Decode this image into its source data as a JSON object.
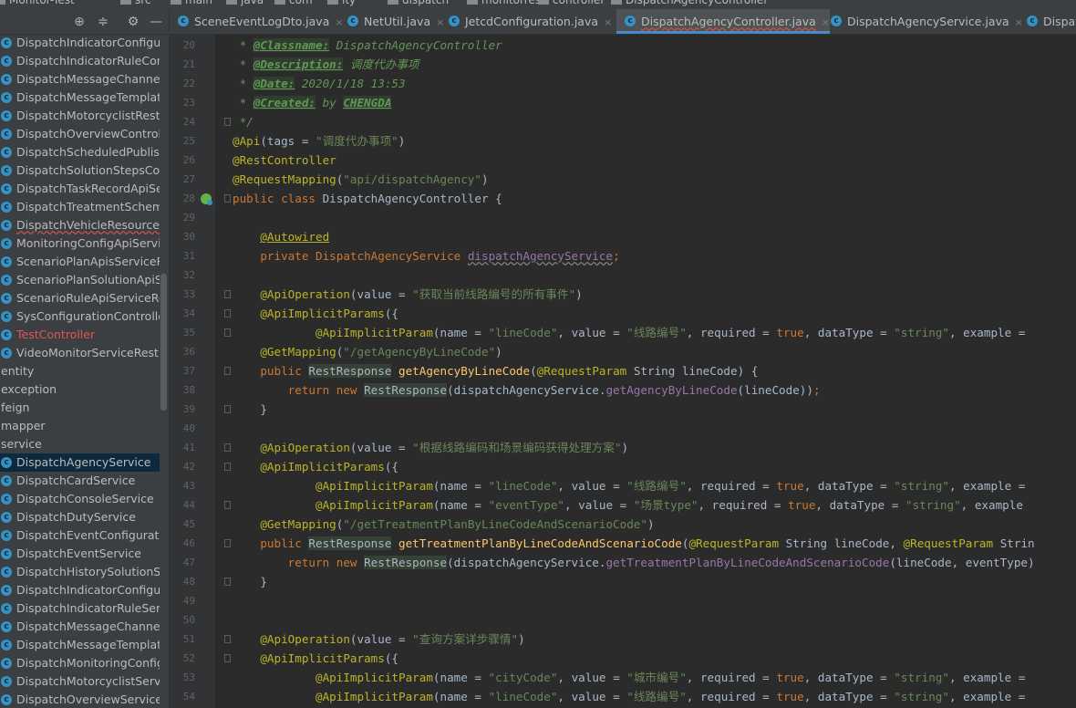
{
  "breadcrumb": [
    "Monitor-Test",
    "src",
    "main",
    "java",
    "com",
    "ity",
    "dispatch",
    "monitorrest",
    "controller",
    "DispatchAgencyController"
  ],
  "project_toolbar": {
    "target_icon": "⊕",
    "collapse_icon": "≑",
    "settings_icon": "⚙",
    "hide_icon": "—"
  },
  "tree": [
    {
      "label": "DispatchIndicatorConfigurati",
      "kind": "class"
    },
    {
      "label": "DispatchIndicatorRuleContro",
      "kind": "class"
    },
    {
      "label": "DispatchMessageChannelCor",
      "kind": "class"
    },
    {
      "label": "DispatchMessageTemplateCc",
      "kind": "class"
    },
    {
      "label": "DispatchMotorcyclistRest",
      "kind": "class"
    },
    {
      "label": "DispatchOverviewController",
      "kind": "class"
    },
    {
      "label": "DispatchScheduledPublished",
      "kind": "class"
    },
    {
      "label": "DispatchSolutionStepsContro",
      "kind": "class"
    },
    {
      "label": "DispatchTaskRecordApiServi",
      "kind": "class"
    },
    {
      "label": "DispatchTreatmentSchemeCo",
      "kind": "class"
    },
    {
      "label": "DispatchVehicleResourceRes",
      "kind": "class",
      "state": "squig"
    },
    {
      "label": "MonitoringConfigApiServiceF",
      "kind": "class"
    },
    {
      "label": "ScenarioPlanApisServiceRest",
      "kind": "class"
    },
    {
      "label": "ScenarioPlanSolutionApiServ",
      "kind": "class"
    },
    {
      "label": "ScenarioRuleApiServiceRest",
      "kind": "class"
    },
    {
      "label": "SysConfigurationController",
      "kind": "class"
    },
    {
      "label": "TestController",
      "kind": "class",
      "state": "error"
    },
    {
      "label": "VideoMonitorServiceRest",
      "kind": "class"
    },
    {
      "label": "entity",
      "kind": "folder"
    },
    {
      "label": "exception",
      "kind": "folder"
    },
    {
      "label": "feign",
      "kind": "folder"
    },
    {
      "label": "mapper",
      "kind": "folder"
    },
    {
      "label": "service",
      "kind": "folder"
    },
    {
      "label": "DispatchAgencyService",
      "kind": "class",
      "state": "selected"
    },
    {
      "label": "DispatchCardService",
      "kind": "class"
    },
    {
      "label": "DispatchConsoleService",
      "kind": "class"
    },
    {
      "label": "DispatchDutyService",
      "kind": "class"
    },
    {
      "label": "DispatchEventConfigurationS",
      "kind": "class"
    },
    {
      "label": "DispatchEventService",
      "kind": "class"
    },
    {
      "label": "DispatchHistorySolutionServi",
      "kind": "class"
    },
    {
      "label": "DispatchIndicatorConfigurati",
      "kind": "class"
    },
    {
      "label": "DispatchIndicatorRuleService",
      "kind": "class"
    },
    {
      "label": "DispatchMessageChannelSer",
      "kind": "class"
    },
    {
      "label": "DispatchMessageTemplateSe",
      "kind": "class"
    },
    {
      "label": "DispatchMonitoringConfigSe",
      "kind": "class"
    },
    {
      "label": "DispatchMotorcyclistService",
      "kind": "class"
    },
    {
      "label": "DispatchOverviewService",
      "kind": "class"
    }
  ],
  "tabs": [
    {
      "label": "SceneEventLogDto.java",
      "close": "×"
    },
    {
      "label": "NetUtil.java",
      "close": "×"
    },
    {
      "label": "JetcdConfiguration.java",
      "close": "×"
    },
    {
      "label": "DispatchAgencyController.java",
      "close": "×",
      "active": true
    },
    {
      "label": "DispatchAgencyService.java",
      "close": "×"
    },
    {
      "label": "Dispatch",
      "close": ""
    }
  ],
  "code": {
    "line_numbers": [
      "20",
      "21",
      "22",
      "23",
      "24",
      "25",
      "26",
      "27",
      "28",
      "29",
      "30",
      "31",
      "32",
      "33",
      "34",
      "35",
      "36",
      "37",
      "38",
      "39",
      "40",
      "41",
      "42",
      "43",
      "44",
      "45",
      "46",
      "47",
      "48",
      "49",
      "50",
      "51",
      "52",
      "53",
      "54"
    ],
    "lines": [
      [
        [
          "c-cm",
          " * "
        ],
        [
          "c-tag",
          "@Classname:"
        ],
        [
          "c-cm",
          " DispatchAgencyController"
        ]
      ],
      [
        [
          "c-cm",
          " * "
        ],
        [
          "c-tag",
          "@Description:"
        ],
        [
          "c-cm",
          " 调度代办事项"
        ]
      ],
      [
        [
          "c-cm",
          " * "
        ],
        [
          "c-tag",
          "@Date:"
        ],
        [
          "c-cm",
          " 2020/1/18 13:53"
        ]
      ],
      [
        [
          "c-cm",
          " * "
        ],
        [
          "c-tag",
          "@Created:"
        ],
        [
          "c-cm",
          " by "
        ],
        [
          "c-tag",
          "CHENGDA"
        ]
      ],
      [
        [
          "c-cm",
          " */"
        ]
      ],
      [
        [
          "c-ann",
          "@Api"
        ],
        [
          "",
          "(tags = "
        ],
        [
          "c-str",
          "\"调度代办事项\""
        ],
        [
          "",
          ")"
        ]
      ],
      [
        [
          "c-ann",
          "@RestController"
        ]
      ],
      [
        [
          "c-ann",
          "@RequestMapping"
        ],
        [
          "",
          "("
        ],
        [
          "c-str",
          "\"api/dispatchAgency\""
        ],
        [
          "",
          ")"
        ]
      ],
      [
        [
          "c-kw",
          "public class "
        ],
        [
          "",
          "DispatchAgencyController {"
        ]
      ],
      [
        [
          "",
          ""
        ]
      ],
      [
        [
          "",
          "    "
        ],
        [
          "c-ann-u",
          "@Autowired"
        ]
      ],
      [
        [
          "",
          "    "
        ],
        [
          "c-kw",
          "private "
        ],
        [
          "c-err",
          "DispatchAgencyService "
        ],
        [
          "c-fld",
          "dispatchAgencyService"
        ],
        [
          "c-kw",
          ";"
        ]
      ],
      [
        [
          "",
          ""
        ]
      ],
      [
        [
          "",
          "    "
        ],
        [
          "c-ann",
          "@ApiOperation"
        ],
        [
          "",
          "(value = "
        ],
        [
          "c-str",
          "\"获取当前线路编号的所有事件\""
        ],
        [
          "",
          ")"
        ]
      ],
      [
        [
          "",
          "    "
        ],
        [
          "c-ann",
          "@ApiImplicitParams"
        ],
        [
          "",
          "({"
        ]
      ],
      [
        [
          "",
          "            "
        ],
        [
          "c-ann",
          "@ApiImplicitParam"
        ],
        [
          "",
          "(name = "
        ],
        [
          "c-str",
          "\"lineCode\""
        ],
        [
          "",
          ", value = "
        ],
        [
          "c-str",
          "\"线路编号\""
        ],
        [
          "",
          ", required = "
        ],
        [
          "c-kw",
          "true"
        ],
        [
          "",
          ", dataType = "
        ],
        [
          "c-str",
          "\"string\""
        ],
        [
          "",
          ", example = "
        ]
      ],
      [
        [
          "",
          "    "
        ],
        [
          "c-ann",
          "@GetMapping"
        ],
        [
          "",
          "("
        ],
        [
          "c-str",
          "\"/getAgencyByLineCode\""
        ],
        [
          "",
          ")"
        ]
      ],
      [
        [
          "",
          "    "
        ],
        [
          "c-kw",
          "public "
        ],
        [
          "c-cls",
          "RestResponse"
        ],
        [
          "c-mth",
          " getAgencyByLineCode"
        ],
        [
          "",
          "("
        ],
        [
          "c-ann",
          "@RequestParam"
        ],
        [
          "",
          " String lineCode) {"
        ]
      ],
      [
        [
          "",
          "        "
        ],
        [
          "c-kw",
          "return new "
        ],
        [
          "c-cls",
          "RestResponse"
        ],
        [
          "",
          "(dispatchAgencyService."
        ],
        [
          "c-mcall",
          "getAgencyByLineCode"
        ],
        [
          "",
          "(lineCode))"
        ],
        [
          "c-kw",
          ";"
        ]
      ],
      [
        [
          "",
          "    }"
        ]
      ],
      [
        [
          "",
          ""
        ]
      ],
      [
        [
          "",
          "    "
        ],
        [
          "c-ann",
          "@ApiOperation"
        ],
        [
          "",
          "(value = "
        ],
        [
          "c-str",
          "\"根据线路编码和场景编码获得处理方案\""
        ],
        [
          "",
          ")"
        ]
      ],
      [
        [
          "",
          "    "
        ],
        [
          "c-ann",
          "@ApiImplicitParams"
        ],
        [
          "",
          "({"
        ]
      ],
      [
        [
          "",
          "            "
        ],
        [
          "c-ann",
          "@ApiImplicitParam"
        ],
        [
          "",
          "(name = "
        ],
        [
          "c-str",
          "\"lineCode\""
        ],
        [
          "",
          ", value = "
        ],
        [
          "c-str",
          "\"线路编号\""
        ],
        [
          "",
          ", required = "
        ],
        [
          "c-kw",
          "true"
        ],
        [
          "",
          ", dataType = "
        ],
        [
          "c-str",
          "\"string\""
        ],
        [
          "",
          ", example = "
        ]
      ],
      [
        [
          "",
          "            "
        ],
        [
          "c-ann",
          "@ApiImplicitParam"
        ],
        [
          "",
          "(name = "
        ],
        [
          "c-str",
          "\"eventType\""
        ],
        [
          "",
          ", value = "
        ],
        [
          "c-str",
          "\"场景type\""
        ],
        [
          "",
          ", required = "
        ],
        [
          "c-kw",
          "true"
        ],
        [
          "",
          ", dataType = "
        ],
        [
          "c-str",
          "\"string\""
        ],
        [
          "",
          ", example"
        ]
      ],
      [
        [
          "",
          "    "
        ],
        [
          "c-ann",
          "@GetMapping"
        ],
        [
          "",
          "("
        ],
        [
          "c-str",
          "\"/getTreatmentPlanByLineCodeAndScenarioCode\""
        ],
        [
          "",
          ")"
        ]
      ],
      [
        [
          "",
          "    "
        ],
        [
          "c-kw",
          "public "
        ],
        [
          "c-cls",
          "RestResponse"
        ],
        [
          "c-mth",
          " getTreatmentPlanByLineCodeAndScenarioCode"
        ],
        [
          "",
          "("
        ],
        [
          "c-ann",
          "@RequestParam"
        ],
        [
          "",
          " String lineCode, "
        ],
        [
          "c-ann",
          "@RequestParam"
        ],
        [
          "",
          " Strin"
        ]
      ],
      [
        [
          "",
          "        "
        ],
        [
          "c-kw",
          "return new "
        ],
        [
          "c-cls",
          "RestResponse"
        ],
        [
          "",
          "(dispatchAgencyService."
        ],
        [
          "c-mcall",
          "getTreatmentPlanByLineCodeAndScenarioCode"
        ],
        [
          "",
          "(lineCode, eventType)"
        ]
      ],
      [
        [
          "",
          "    }"
        ]
      ],
      [
        [
          "",
          ""
        ]
      ],
      [
        [
          "",
          ""
        ]
      ],
      [
        [
          "",
          "    "
        ],
        [
          "c-ann",
          "@ApiOperation"
        ],
        [
          "",
          "(value = "
        ],
        [
          "c-str",
          "\"查询方案详步骤情\""
        ],
        [
          "",
          ")"
        ]
      ],
      [
        [
          "",
          "    "
        ],
        [
          "c-ann",
          "@ApiImplicitParams"
        ],
        [
          "",
          "({"
        ]
      ],
      [
        [
          "",
          "            "
        ],
        [
          "c-ann",
          "@ApiImplicitParam"
        ],
        [
          "",
          "(name = "
        ],
        [
          "c-str",
          "\"cityCode\""
        ],
        [
          "",
          ", value = "
        ],
        [
          "c-str",
          "\"城市编号\""
        ],
        [
          "",
          ", required = "
        ],
        [
          "c-kw",
          "true"
        ],
        [
          "",
          ", dataType = "
        ],
        [
          "c-str",
          "\"string\""
        ],
        [
          "",
          ", example = "
        ]
      ],
      [
        [
          "",
          "            "
        ],
        [
          "c-ann",
          "@ApiImplicitParam"
        ],
        [
          "",
          "(name = "
        ],
        [
          "c-str",
          "\"lineCode\""
        ],
        [
          "",
          ", value = "
        ],
        [
          "c-str",
          "\"线路编号\""
        ],
        [
          "",
          ", required = "
        ],
        [
          "c-kw",
          "true"
        ],
        [
          "",
          ", dataType = "
        ],
        [
          "c-str",
          "\"string\""
        ],
        [
          "",
          ", example = "
        ]
      ]
    ]
  }
}
